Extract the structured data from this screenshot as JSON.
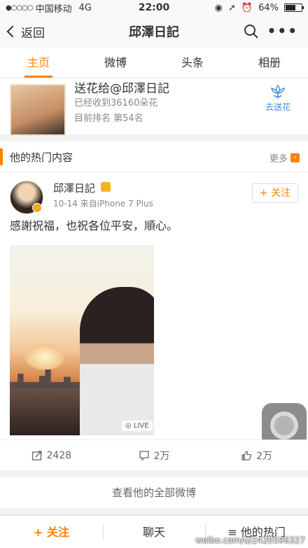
{
  "status_bar": {
    "signal": "●○○○○",
    "carrier": "中国移动",
    "network": "4G",
    "time": "22:00",
    "battery": "64%",
    "battery_level": 0.64
  },
  "nav": {
    "back_label": "返回",
    "title": "邱澤日記"
  },
  "tabs": [
    {
      "label": "主页",
      "active": true
    },
    {
      "label": "微博"
    },
    {
      "label": "头条"
    },
    {
      "label": "相册"
    }
  ],
  "flower": {
    "title": "送花给@邱澤日記",
    "received": "已经收到36160朵花",
    "rank": "目前排名 第54名",
    "give_label": "去送花"
  },
  "hot": {
    "title": "他的热门内容",
    "more_label": "更多"
  },
  "post": {
    "username": "邱澤日記",
    "meta": "10-14  来自iPhone 7 Plus",
    "follow_label": "+ 关注",
    "text": "感謝祝福，也祝各位平安，順心。",
    "live_label": "LIVE"
  },
  "actions": {
    "reposts": "2428",
    "comments": "2万",
    "likes": "2万"
  },
  "view_all_label": "查看他的全部微博",
  "bottom": {
    "follow": "+ 关注",
    "chat": "聊天",
    "hot": "≡ 他的热门"
  },
  "watermark": "weibo.com/u/2420596327",
  "colors": {
    "accent": "#ff8200",
    "link": "#3f8cd6"
  }
}
